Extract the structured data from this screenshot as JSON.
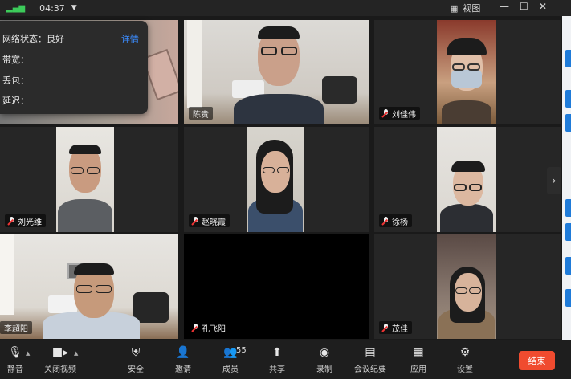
{
  "topbar": {
    "time": "04:37",
    "view_label": "视图"
  },
  "network_popup": {
    "status_label": "网络状态：良好",
    "detail_label": "详情",
    "bandwidth_label": "带宽：",
    "loss_label": "丢包：",
    "latency_label": "延迟："
  },
  "participants": [
    {
      "name": ""
    },
    {
      "name": "陈贵"
    },
    {
      "name": "刘佳伟"
    },
    {
      "name": "刘光维"
    },
    {
      "name": "赵晓霞"
    },
    {
      "name": "徐杨"
    },
    {
      "name": "李超阳"
    },
    {
      "name": "孔飞阳"
    },
    {
      "name": "茂佳"
    }
  ],
  "toolbar": {
    "mute": "静音",
    "stop_video": "关闭视频",
    "security": "安全",
    "invite": "邀请",
    "members": "成员",
    "member_count": "55",
    "share": "共享",
    "record": "录制",
    "minutes": "会议纪要",
    "apps": "应用",
    "settings": "设置",
    "end": "结束"
  },
  "colors": {
    "accent": "#3b8cff",
    "end_button": "#f04b2f",
    "mic_muted": "#e33333"
  }
}
